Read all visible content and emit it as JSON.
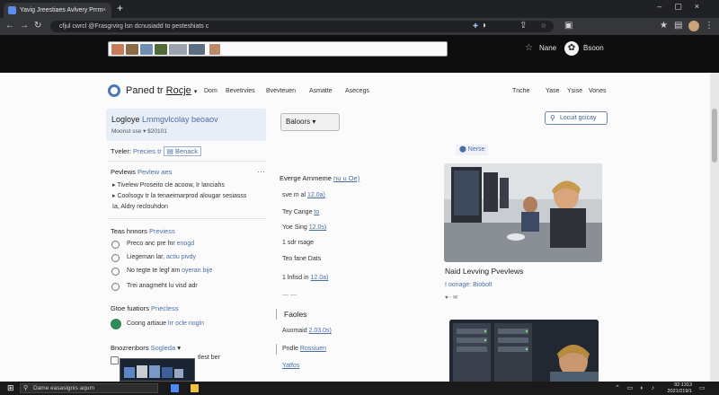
{
  "browser": {
    "tab_title": "Yavig Jreestiaes Avlvery Prrm",
    "tab_close": "×",
    "new_tab": "+",
    "window_controls": [
      "–",
      "▢",
      "×"
    ],
    "url": "cfjul cwrcl @Frasgrvirg lsn dcnusiadd to pesteshiats c",
    "nav_icons": [
      "back-icon",
      "forward-icon",
      "reload-icon"
    ]
  },
  "site_header": {
    "account_label": "Nane",
    "user_label": "Bsoon"
  },
  "brand": {
    "prefix": "Paned tr ",
    "suffix": "Rocje"
  },
  "main_nav": [
    "Dom",
    "Bevetrvies",
    "Bvevteuen",
    "Asmatte",
    "Asecegs"
  ],
  "right_nav": [
    "Tnche",
    "Yase",
    "Ysise",
    "Vones"
  ],
  "profile_card": {
    "name_prefix": "Logloye ",
    "name_highlight": "Lmmgvlcolay beoaov",
    "sub_prefix": "Moonst sse",
    "sub_value": "$20101"
  },
  "filter_dropdown": {
    "label": "Baloors"
  },
  "action_button": {
    "label": "Locuit gcicay"
  },
  "left_column": {
    "toolbar": {
      "label": "Tveler:",
      "link1": "Precies tr",
      "link2": "Benack"
    },
    "reviews": {
      "heading": "Pevlews",
      "heading_link": "Pevlew aes",
      "more": "…",
      "bullets": [
        "▸ Tivelew Proseito cle acoow, Ir lanciahs",
        "▸ Coolsogv tr la tenaeimarprod alougar sesiasss",
        "Ia, Aldry reclouhdon"
      ]
    },
    "honors": {
      "heading": "Teas hnnors",
      "heading_link": "Previess",
      "items": [
        {
          "text": "Preco anc pre fnr ",
          "link": "enogd"
        },
        {
          "text": "Liegeman lar, ",
          "link": "actiu pivdy"
        },
        {
          "text": "No tegte te legf am ",
          "link": "oyeran bije"
        },
        {
          "text": "Trei anagmeht lu visd adr",
          "link": ""
        }
      ]
    },
    "features": {
      "heading": "Gtoe fuatiors",
      "heading_link": "Pnecless",
      "item": {
        "text": "Coong artiaue ",
        "link": "lrr ocle nogln"
      }
    },
    "bottom": {
      "heading": "Bnozrenbors",
      "heading_link": "Sogleda",
      "caption": "tlest ber"
    }
  },
  "middle_column": {
    "header": "Everge Arnmeme",
    "header_link": "nu u Oe)",
    "lines": [
      {
        "prefix": "sve m al ",
        "link": "12.0a)"
      },
      {
        "prefix": "Tey Cange ",
        "link": "to"
      },
      {
        "prefix": "Yoe Sing ",
        "link": "12.0s)"
      },
      {
        "prefix": "1 sdr rsage",
        "link": ""
      },
      {
        "prefix": "Teo fane Dats",
        "link": ""
      },
      {
        "prefix": "1 lnfisd in ",
        "link": "12.0a)"
      }
    ],
    "divider": "— —",
    "section2_heading": "Faoles",
    "section2_lines": [
      {
        "prefix": "Auomaid ",
        "link": "2.03.0s)"
      },
      {
        "prefix": "Pndle ",
        "link": "Rossiuen"
      },
      {
        "prefix": "",
        "link": "Yatfos"
      }
    ]
  },
  "right_column": {
    "pill": "Nerse",
    "card1_title": "Naid Levving Pvevlews",
    "card1_sub_prefix": "I ",
    "card1_sub_link": "oonage: Biobolt",
    "card1_meta": "♥ ◦ ✉"
  },
  "taskbar": {
    "search_placeholder": "Dame easasignis aqum",
    "clock_time": "92:1313",
    "clock_date": "2021/219/1"
  }
}
